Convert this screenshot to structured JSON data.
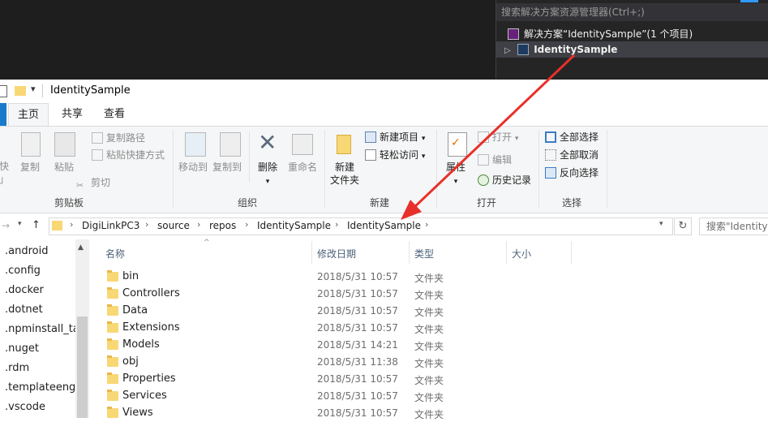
{
  "solution_explorer": {
    "search_placeholder": "搜索解决方案资源管理器(Ctrl+;)",
    "solution_label": "解决方案“IdentitySample”(1 个项目)",
    "project_label": "IdentitySample"
  },
  "window": {
    "title": "IdentitySample"
  },
  "ribbon": {
    "tabs": [
      "主页",
      "共享",
      "查看"
    ],
    "pin_partial": "快",
    "pin_partial2": "」",
    "clipboard": {
      "copy": "复制",
      "paste": "粘贴",
      "copy_path": "复制路径",
      "paste_shortcut": "粘贴快捷方式",
      "cut": "剪切",
      "label": "剪贴板"
    },
    "organize": {
      "move_to": "移动到",
      "copy_to": "复制到",
      "delete": "删除",
      "rename": "重命名",
      "label": "组织"
    },
    "new": {
      "new_folder_line1": "新建",
      "new_folder_line2": "文件夹",
      "new_item": "新建项目",
      "easy_access": "轻松访问",
      "label": "新建"
    },
    "open": {
      "properties": "属性",
      "open": "打开",
      "edit": "编辑",
      "history": "历史记录",
      "label": "打开"
    },
    "select": {
      "select_all": "全部选择",
      "select_none": "全部取消",
      "invert": "反向选择",
      "label": "选择"
    }
  },
  "address": {
    "crumbs": [
      "DigiLinkPC3",
      "source",
      "repos",
      "IdentitySample",
      "IdentitySample"
    ],
    "search_placeholder": "搜索\"IdentitySample\""
  },
  "nav_pane": [
    ".android",
    ".config",
    ".docker",
    ".dotnet",
    ".npminstall_tarb",
    ".nuget",
    ".rdm",
    ".templateengin",
    ".vscode"
  ],
  "columns": {
    "name": "名称",
    "date": "修改日期",
    "type": "类型",
    "size": "大小"
  },
  "files": [
    {
      "name": "bin",
      "date": "2018/5/31 10:57",
      "type": "文件夹"
    },
    {
      "name": "Controllers",
      "date": "2018/5/31 10:57",
      "type": "文件夹"
    },
    {
      "name": "Data",
      "date": "2018/5/31 10:57",
      "type": "文件夹"
    },
    {
      "name": "Extensions",
      "date": "2018/5/31 10:57",
      "type": "文件夹"
    },
    {
      "name": "Models",
      "date": "2018/5/31 14:21",
      "type": "文件夹"
    },
    {
      "name": "obj",
      "date": "2018/5/31 11:38",
      "type": "文件夹"
    },
    {
      "name": "Properties",
      "date": "2018/5/31 10:57",
      "type": "文件夹"
    },
    {
      "name": "Services",
      "date": "2018/5/31 10:57",
      "type": "文件夹"
    },
    {
      "name": "Views",
      "date": "2018/5/31 10:57",
      "type": "文件夹"
    }
  ],
  "colors": {
    "annotation_arrow": "#e8302a",
    "vs_dark": "#1e1e1e",
    "ribbon_bg": "#f5f6f7",
    "folder": "#f8d775"
  }
}
